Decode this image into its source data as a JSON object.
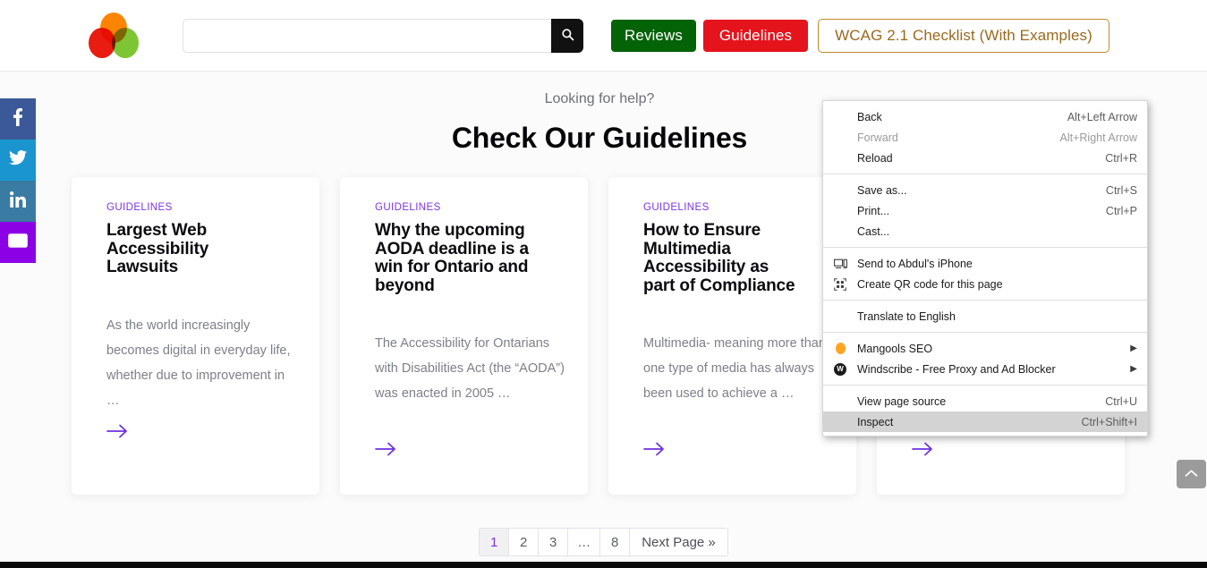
{
  "header": {
    "logo_name": "brand-logo",
    "logo_colors": {
      "orange": "#ff8400",
      "red": "#e81c10",
      "green": "#7dc532"
    },
    "search": {
      "value": "",
      "placeholder": "",
      "button_icon": "search-icon"
    },
    "buttons": [
      {
        "name": "reviews-button",
        "label": "Reviews",
        "bg": "#046307",
        "color": "#ffffff"
      },
      {
        "name": "guidelines-button",
        "label": "Guidelines",
        "bg": "#e5141c",
        "color": "#ffffff"
      },
      {
        "name": "wcag-checklist-button",
        "label": "WCAG 2.1 Checklist (With Examples)",
        "bg": "#ffffff",
        "color": "#9a6a1e"
      }
    ]
  },
  "social": [
    {
      "name": "facebook-share",
      "icon": "facebook-icon",
      "color": "#3b5998"
    },
    {
      "name": "twitter-share",
      "icon": "twitter-icon",
      "color": "#1b95d0"
    },
    {
      "name": "linkedin-share",
      "icon": "linkedin-icon",
      "color": "#3a7ba3"
    },
    {
      "name": "email-share",
      "icon": "envelope-icon",
      "color": "#8c00e6"
    }
  ],
  "page": {
    "eyebrow": "Looking for help?",
    "title": "Check Our Guidelines"
  },
  "cards": [
    {
      "tag": "GUIDELINES",
      "title": "Largest Web\nAccessibility\nLawsuits",
      "excerpt": "As the world increasingly becomes digital in everyday life, whether due to improvement in …",
      "arrow_icon": "arrow-right-icon"
    },
    {
      "tag": "GUIDELINES",
      "title": "Why the upcoming\nAODA deadline is a\nwin for Ontario and\nbeyond",
      "excerpt": "The Accessibility for Ontarians with Disabilities Act (the “AODA”) was enacted in 2005 …",
      "arrow_icon": "arrow-right-icon"
    },
    {
      "tag": "GUIDELINES",
      "title": "How to Ensure\nMultimedia\nAccessibility as\npart of Compliance",
      "excerpt": "Multimedia- meaning more than one type of media has always been used to achieve a …",
      "arrow_icon": "arrow-right-icon"
    },
    {
      "tag": "",
      "title": "",
      "excerpt": "",
      "arrow_icon": "arrow-right-icon"
    }
  ],
  "pagination": {
    "pages": [
      "1",
      "2",
      "3",
      "…",
      "8"
    ],
    "active_index": 0,
    "next_label": "Next Page »"
  },
  "scroll_top": {
    "name": "scroll-to-top-button",
    "icon": "chevron-up-icon"
  },
  "context_menu": {
    "groups": [
      [
        {
          "label": "Back",
          "accel": "Alt+Left Arrow",
          "disabled": false,
          "icon": ""
        },
        {
          "label": "Forward",
          "accel": "Alt+Right Arrow",
          "disabled": true,
          "icon": ""
        },
        {
          "label": "Reload",
          "accel": "Ctrl+R",
          "disabled": false,
          "icon": ""
        }
      ],
      [
        {
          "label": "Save as...",
          "accel": "Ctrl+S",
          "disabled": false,
          "icon": ""
        },
        {
          "label": "Print...",
          "accel": "Ctrl+P",
          "disabled": false,
          "icon": ""
        },
        {
          "label": "Cast...",
          "accel": "",
          "disabled": false,
          "icon": ""
        }
      ],
      [
        {
          "label": "Send to Abdul's iPhone",
          "accel": "",
          "disabled": false,
          "icon": "cast-device-icon"
        },
        {
          "label": "Create QR code for this page",
          "accel": "",
          "disabled": false,
          "icon": "qr-code-icon"
        }
      ],
      [
        {
          "label": "Translate to English",
          "accel": "",
          "disabled": false,
          "icon": ""
        }
      ],
      [
        {
          "label": "Mangools SEO",
          "accel": "",
          "disabled": false,
          "icon": "mangools-icon",
          "submenu": true
        },
        {
          "label": "Windscribe - Free Proxy and Ad Blocker",
          "accel": "",
          "disabled": false,
          "icon": "windscribe-icon",
          "submenu": true
        }
      ],
      [
        {
          "label": "View page source",
          "accel": "Ctrl+U",
          "disabled": false,
          "icon": ""
        },
        {
          "label": "Inspect",
          "accel": "Ctrl+Shift+I",
          "disabled": false,
          "icon": "",
          "selected": true
        }
      ]
    ]
  }
}
